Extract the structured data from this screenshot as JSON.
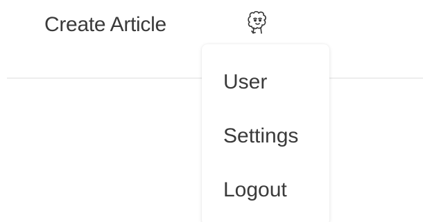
{
  "nav": {
    "create_article_label": "Create Article",
    "avatar_icon": "sheep-avatar-icon"
  },
  "user_menu": {
    "items": [
      {
        "label": "User"
      },
      {
        "label": "Settings"
      },
      {
        "label": "Logout"
      }
    ]
  }
}
